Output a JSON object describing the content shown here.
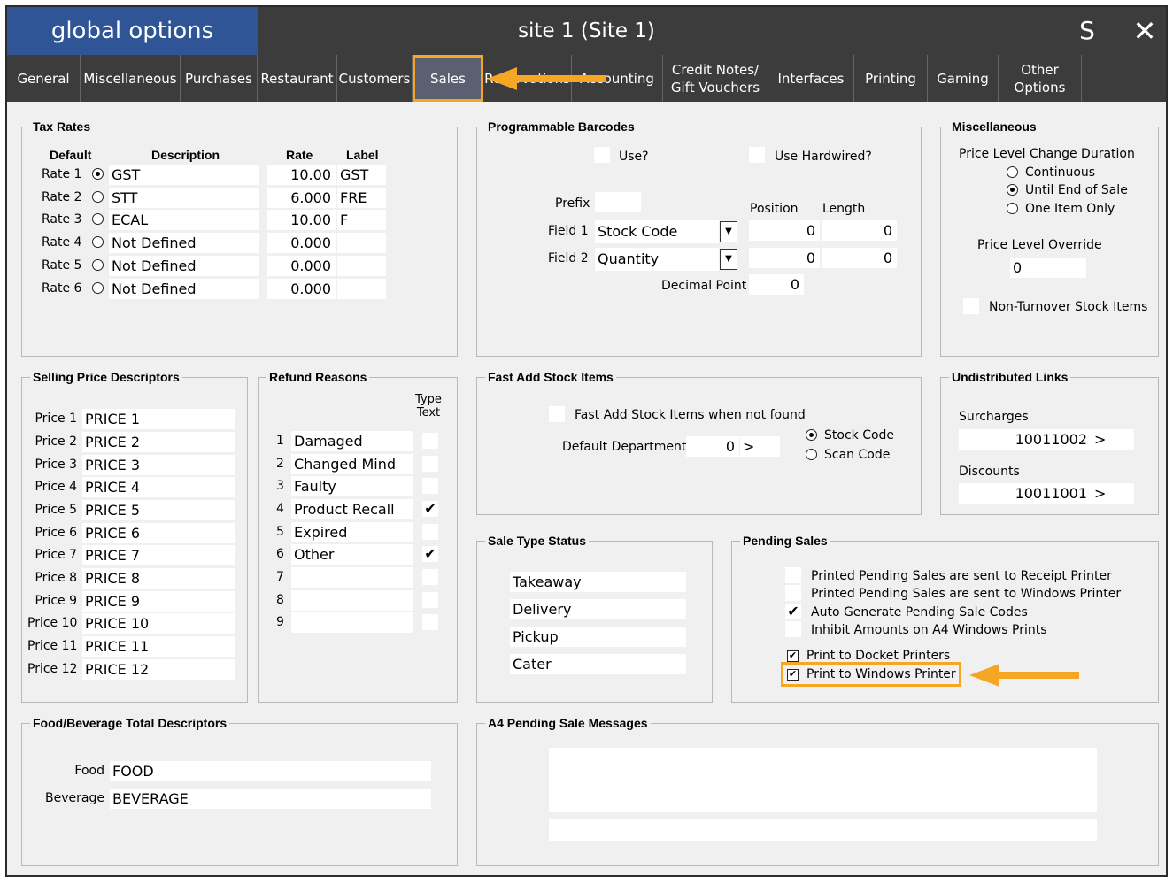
{
  "app_title": "global options",
  "site_title": "site 1   (Site 1)",
  "window_buttons": {
    "s_label": "S",
    "close_label": "✕"
  },
  "tabs": [
    {
      "label": "General"
    },
    {
      "label": "Miscellaneous"
    },
    {
      "label": "Purchases"
    },
    {
      "label": "Restaurant"
    },
    {
      "label": "Customers"
    },
    {
      "label": "Sales",
      "active": true
    },
    {
      "label": "Reservations"
    },
    {
      "label": "Accounting"
    },
    {
      "label": "Credit Notes/\nGift Vouchers"
    },
    {
      "label": "Interfaces"
    },
    {
      "label": "Printing"
    },
    {
      "label": "Gaming"
    },
    {
      "label": "Other\nOptions"
    }
  ],
  "tax_rates": {
    "title": "Tax Rates",
    "headers": {
      "default": "Default",
      "description": "Description",
      "rate": "Rate",
      "label": "Label"
    },
    "rows": [
      {
        "name": "Rate 1",
        "selected": true,
        "description": "GST",
        "rate": "10.00",
        "label": "GST"
      },
      {
        "name": "Rate 2",
        "selected": false,
        "description": "STT",
        "rate": "6.000",
        "label": "FRE"
      },
      {
        "name": "Rate 3",
        "selected": false,
        "description": "ECAL",
        "rate": "10.00",
        "label": "F"
      },
      {
        "name": "Rate 4",
        "selected": false,
        "description": "Not Defined",
        "rate": "0.000",
        "label": ""
      },
      {
        "name": "Rate 5",
        "selected": false,
        "description": "Not Defined",
        "rate": "0.000",
        "label": ""
      },
      {
        "name": "Rate 6",
        "selected": false,
        "description": "Not Defined",
        "rate": "0.000",
        "label": ""
      }
    ]
  },
  "barcodes": {
    "title": "Programmable Barcodes",
    "use_label": "Use?",
    "use_checked": false,
    "hardwired_label": "Use Hardwired?",
    "hardwired_checked": false,
    "prefix_label": "Prefix",
    "prefix_value": "",
    "position_label": "Position",
    "length_label": "Length",
    "field1_label": "Field 1",
    "field1_value": "Stock Code",
    "field1_position": "0",
    "field1_length": "0",
    "field2_label": "Field 2",
    "field2_value": "Quantity",
    "field2_position": "0",
    "field2_length": "0",
    "decimal_label": "Decimal Point",
    "decimal_value": "0"
  },
  "misc": {
    "title": "Miscellaneous",
    "duration_label": "Price Level Change Duration",
    "options": [
      {
        "label": "Continuous",
        "selected": false
      },
      {
        "label": "Until End of Sale",
        "selected": true
      },
      {
        "label": "One Item Only",
        "selected": false
      }
    ],
    "override_label": "Price Level Override",
    "override_value": "0",
    "non_turnover_label": "Non-Turnover Stock Items",
    "non_turnover_checked": false
  },
  "selling_price": {
    "title": "Selling Price Descriptors",
    "rows": [
      {
        "name": "Price 1",
        "value": "PRICE 1"
      },
      {
        "name": "Price 2",
        "value": "PRICE 2"
      },
      {
        "name": "Price 3",
        "value": "PRICE 3"
      },
      {
        "name": "Price 4",
        "value": "PRICE 4"
      },
      {
        "name": "Price 5",
        "value": "PRICE 5"
      },
      {
        "name": "Price 6",
        "value": "PRICE 6"
      },
      {
        "name": "Price 7",
        "value": "PRICE 7"
      },
      {
        "name": "Price 8",
        "value": "PRICE 8"
      },
      {
        "name": "Price 9",
        "value": "PRICE 9"
      },
      {
        "name": "Price 10",
        "value": "PRICE 10"
      },
      {
        "name": "Price 11",
        "value": "PRICE 11"
      },
      {
        "name": "Price 12",
        "value": "PRICE 12"
      }
    ]
  },
  "refund": {
    "title": "Refund Reasons",
    "type_text_label": "Type\nText",
    "rows": [
      {
        "num": "1",
        "value": "Damaged",
        "checked": false
      },
      {
        "num": "2",
        "value": "Changed Mind",
        "checked": false
      },
      {
        "num": "3",
        "value": "Faulty",
        "checked": false
      },
      {
        "num": "4",
        "value": "Product Recall",
        "checked": true
      },
      {
        "num": "5",
        "value": "Expired",
        "checked": false
      },
      {
        "num": "6",
        "value": "Other",
        "checked": true
      },
      {
        "num": "7",
        "value": "",
        "checked": false
      },
      {
        "num": "8",
        "value": "",
        "checked": false
      },
      {
        "num": "9",
        "value": "",
        "checked": false
      }
    ]
  },
  "fast_add": {
    "title": "Fast Add Stock Items",
    "when_not_found_label": "Fast Add Stock Items when not found",
    "when_not_found_checked": false,
    "dept_label": "Default Department",
    "dept_value": "0",
    "dept_btn": ">",
    "options": [
      {
        "label": "Stock Code",
        "selected": true
      },
      {
        "label": "Scan Code",
        "selected": false
      }
    ]
  },
  "undistributed": {
    "title": "Undistributed Links",
    "surcharges_label": "Surcharges",
    "surcharges_value": "10011002",
    "discounts_label": "Discounts",
    "discounts_value": "10011001",
    "btn": ">"
  },
  "sale_type": {
    "title": "Sale Type Status",
    "items": [
      "Takeaway",
      "Delivery",
      "Pickup",
      "Cater"
    ]
  },
  "pending": {
    "title": "Pending Sales",
    "items": [
      {
        "label": "Printed Pending Sales are sent to Receipt Printer",
        "checked": false
      },
      {
        "label": "Printed Pending Sales are sent to Windows Printer",
        "checked": false
      },
      {
        "label": "Auto Generate Pending Sale Codes",
        "checked": true
      },
      {
        "label": "Inhibit Amounts on A4 Windows Prints",
        "checked": false
      }
    ],
    "docket_label": "Print to Docket Printers",
    "docket_checked": true,
    "windows_label": "Print to Windows Printer",
    "windows_checked": true
  },
  "food_bev": {
    "title": "Food/Beverage Total Descriptors",
    "food_label": "Food",
    "food_value": "FOOD",
    "bev_label": "Beverage",
    "bev_value": "BEVERAGE"
  },
  "a4": {
    "title": "A4 Pending Sale Messages",
    "message": "",
    "footer": ""
  },
  "colors": {
    "title_accent": "#2f5597",
    "dark_bar": "#3c3c3c",
    "highlight": "#f5a623"
  }
}
